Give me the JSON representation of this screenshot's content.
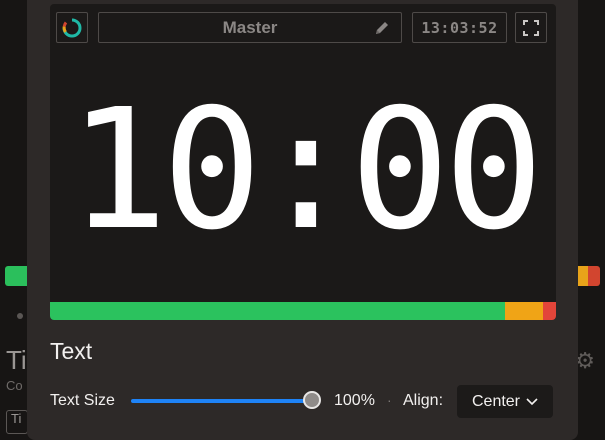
{
  "background": {
    "title_partial": "Ti",
    "subtitle_partial": "Co",
    "input_partial": "Ti"
  },
  "preview": {
    "title": "Master",
    "clock": "13:03:52",
    "timer": "10:00",
    "progress": {
      "green_fraction": 0.9,
      "orange_fraction": 0.075,
      "red_fraction": 0.025,
      "colors": {
        "green": "#2bc25e",
        "orange": "#f0a416",
        "red": "#e3453a"
      }
    },
    "icons": [
      "logo-ring-icon",
      "pencil-icon",
      "fullscreen-icon"
    ]
  },
  "text_section": {
    "title": "Text",
    "text_size_label": "Text Size",
    "text_size_value": "100%",
    "text_size_fraction": 1.0,
    "separator": "·",
    "align_label": "Align:",
    "align_value": "Center"
  },
  "colors": {
    "accent": "#1e83f7"
  }
}
